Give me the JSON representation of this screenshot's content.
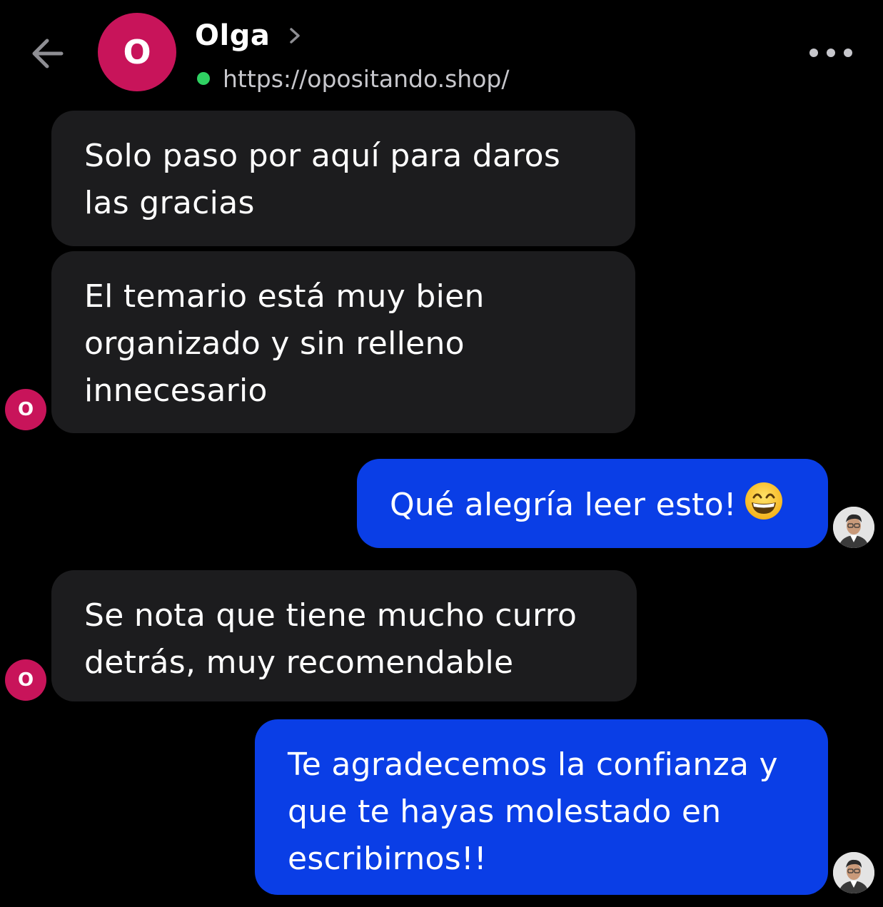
{
  "header": {
    "contact_initial": "O",
    "contact_name": "Olga",
    "contact_url": "https://opositando.shop/",
    "status": "online",
    "icons": {
      "back": "arrow-left-icon",
      "chevron": "chevron-right-icon",
      "more": "more-horizontal-icon"
    }
  },
  "colors": {
    "background": "#000000",
    "incoming_bubble": "#1c1c1e",
    "outgoing_bubble": "#0a3ee6",
    "avatar": "#c8145a",
    "online": "#2fd162"
  },
  "messages": [
    {
      "direction": "incoming",
      "lines": [
        "Solo paso por aquí para daros",
        "las gracias"
      ]
    },
    {
      "direction": "incoming",
      "lines": [
        "El temario está muy bien",
        "organizado y sin relleno",
        "innecesario"
      ],
      "avatar_initial": "O"
    },
    {
      "direction": "outgoing",
      "lines": [
        "Qué alegría leer esto!"
      ],
      "emoji": "grinning-face-with-smiling-eyes"
    },
    {
      "direction": "incoming",
      "lines": [
        "Se nota que tiene mucho curro",
        "detrás, muy recomendable"
      ],
      "avatar_initial": "O"
    },
    {
      "direction": "outgoing",
      "lines": [
        "Te agradecemos la confianza y",
        "que te hayas molestado en",
        "escribirnos!!"
      ]
    }
  ]
}
